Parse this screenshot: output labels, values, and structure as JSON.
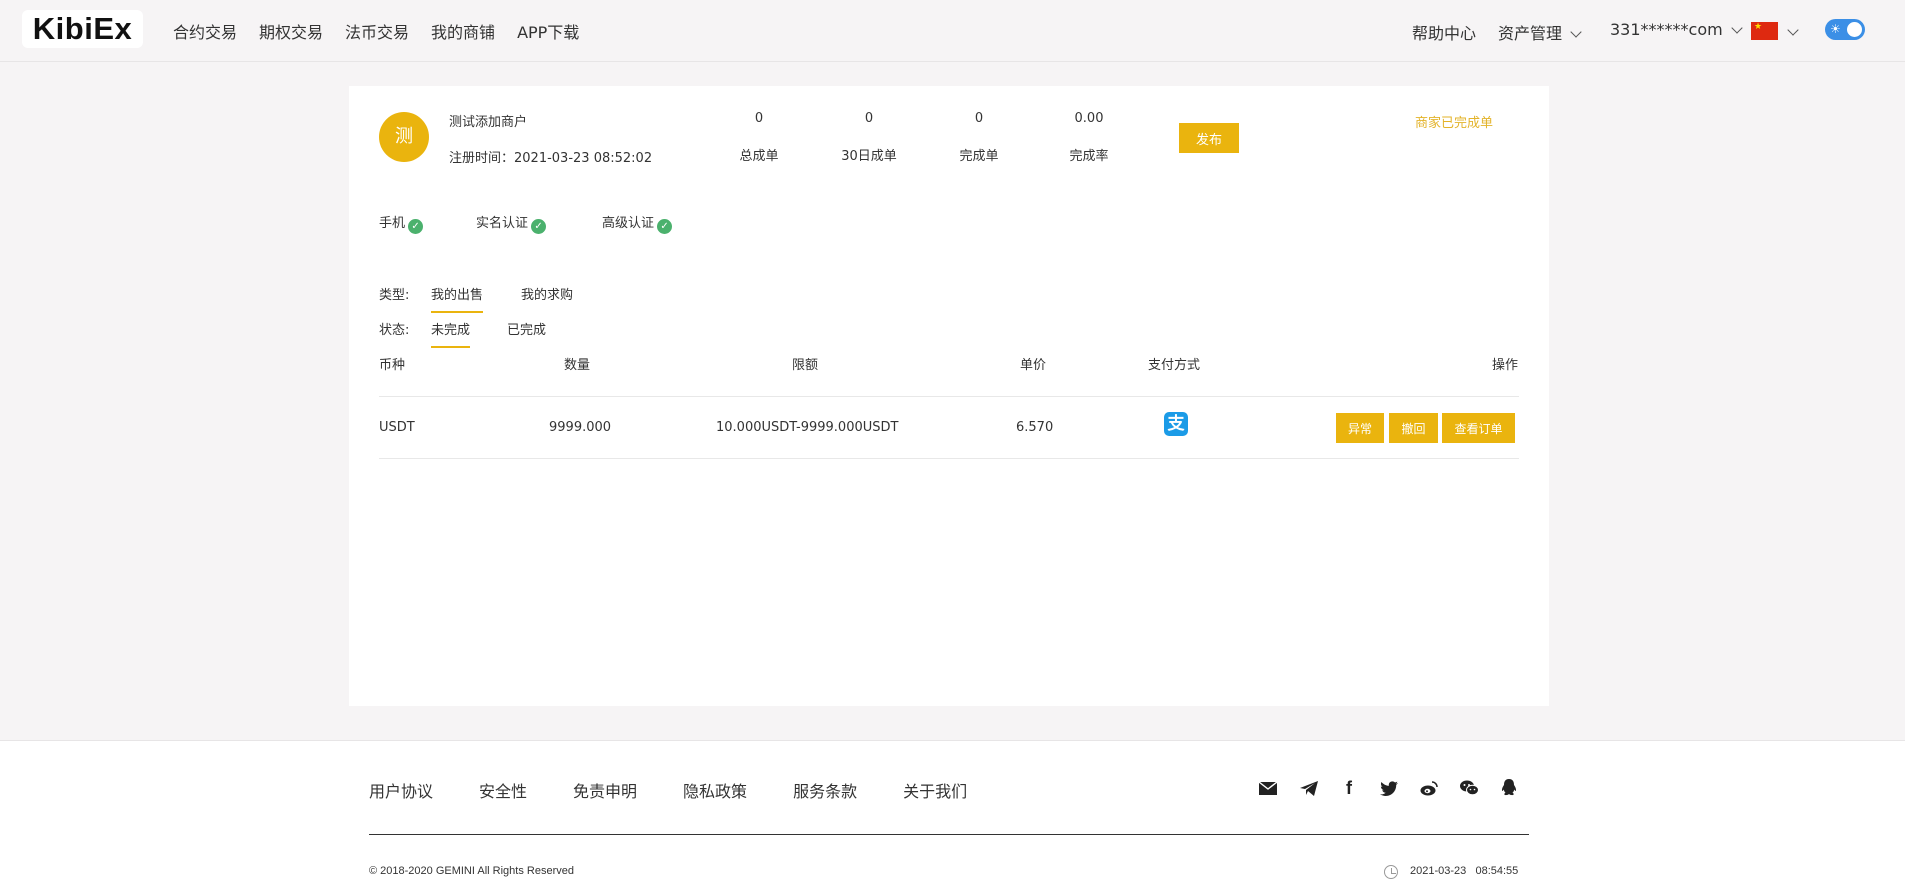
{
  "header": {
    "logo": "KibiEx",
    "nav": [
      "合约交易",
      "期权交易",
      "法币交易",
      "我的商铺",
      "APP下载"
    ],
    "help": "帮助中心",
    "assets": "资产管理",
    "account": "331******com",
    "theme_icon": "sun-icon",
    "flag_icon": "china-flag-icon"
  },
  "merchant": {
    "avatar": "测",
    "name": "测试添加商户",
    "reg_label": "注册时间：",
    "reg_time": "2021-03-23 08:52:02",
    "stats": [
      {
        "value": "0",
        "label": "总成单"
      },
      {
        "value": "0",
        "label": "30日成单"
      },
      {
        "value": "0",
        "label": "完成单"
      },
      {
        "value": "0.00",
        "label": "完成率"
      }
    ],
    "publish": "发布",
    "completed_link": "商家已完成单",
    "verifications": [
      "手机",
      "实名认证",
      "高级认证"
    ]
  },
  "filters": {
    "type_label": "类型:",
    "type_options": [
      "我的出售",
      "我的求购"
    ],
    "status_label": "状态:",
    "status_options": [
      "未完成",
      "已完成"
    ]
  },
  "table": {
    "headers": [
      "币种",
      "数量",
      "限额",
      "单价",
      "支付方式",
      "操作"
    ],
    "rows": [
      {
        "coin": "USDT",
        "amount": "9999.000",
        "limit": "10.000USDT-9999.000USDT",
        "price": "6.570",
        "payment_icon": "alipay-icon",
        "payment_glyph": "支",
        "actions": [
          "异常",
          "撤回",
          "查看订单"
        ]
      }
    ]
  },
  "footer": {
    "links": [
      "用户协议",
      "安全性",
      "免责申明",
      "隐私政策",
      "服务条款",
      "关于我们"
    ],
    "social": [
      "mail-icon",
      "telegram-icon",
      "facebook-icon",
      "twitter-icon",
      "weibo-icon",
      "wechat-icon",
      "qq-icon"
    ],
    "copyright": "© 2018-2020 GEMINI All Rights Reserved",
    "date": "2021-03-23",
    "time": "08:54:55"
  },
  "colors": {
    "accent": "#eab40e",
    "check": "#4bb16d",
    "alipay": "#1b9be7",
    "toggle": "#3b8fe6"
  }
}
